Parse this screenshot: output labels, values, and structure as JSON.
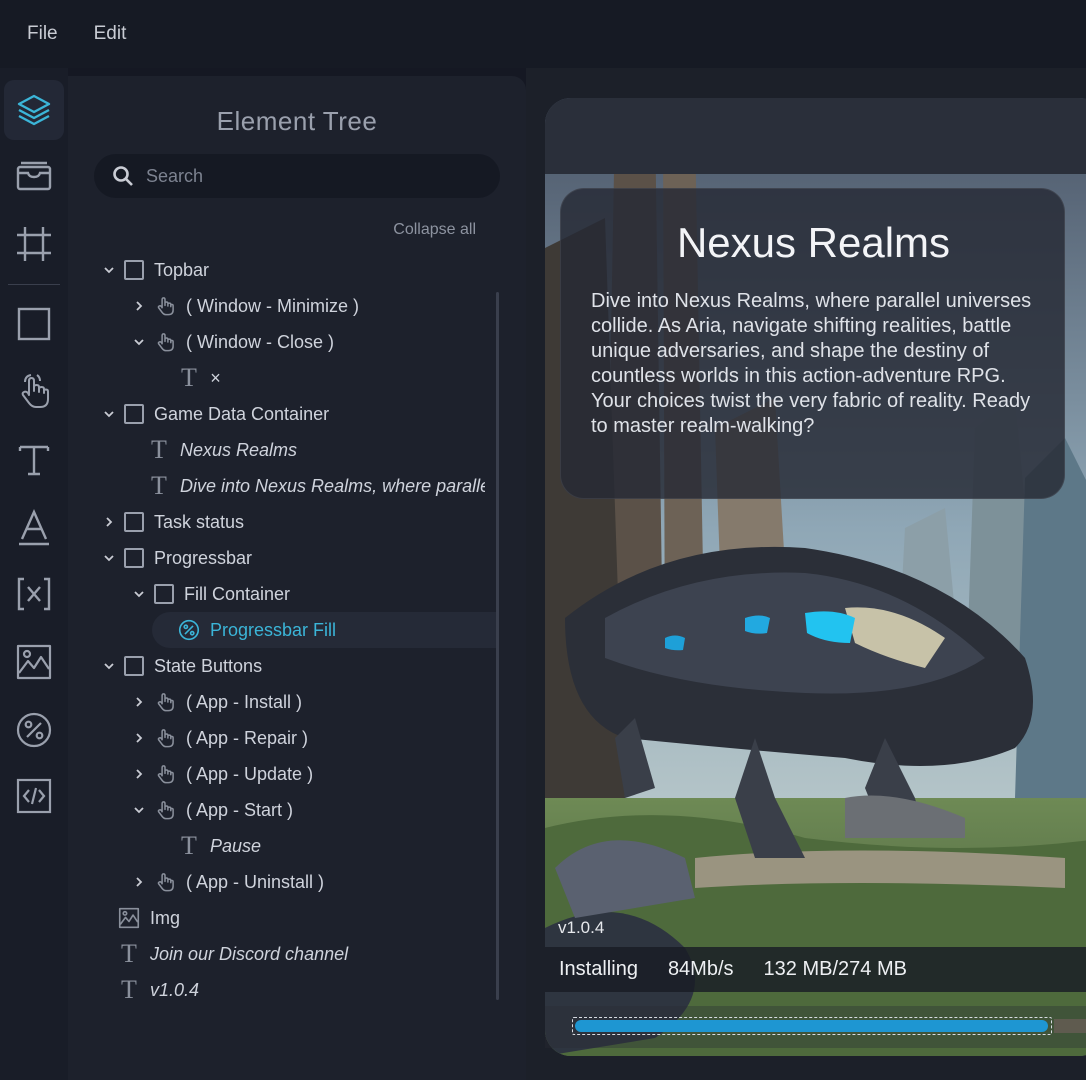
{
  "menu": {
    "file": "File",
    "edit": "Edit"
  },
  "toolbar": {
    "tools": [
      "layers-icon",
      "archive-icon",
      "frame-icon",
      "rectangle-icon",
      "pointer-hand-icon",
      "text-icon",
      "font-icon",
      "variable-icon",
      "image-icon",
      "percent-icon",
      "code-icon"
    ],
    "active": "layers-icon"
  },
  "panel": {
    "title": "Element Tree",
    "search_placeholder": "Search",
    "collapse_all": "Collapse all"
  },
  "tree": {
    "topbar": "Topbar",
    "window_minimize": "( Window - Minimize )",
    "window_close": "( Window - Close )",
    "close_glyph": "×",
    "game_data_container": "Game Data Container",
    "nexus_realms": "Nexus Realms",
    "dive_into": "Dive into Nexus Realms, where parallel",
    "task_status": "Task status",
    "progressbar": "Progressbar",
    "fill_container": "Fill Container",
    "progressbar_fill": "Progressbar Fill",
    "state_buttons": "State Buttons",
    "app_install": "( App - Install )",
    "app_repair": "( App - Repair )",
    "app_update": "( App - Update )",
    "app_start": "( App - Start )",
    "pause": "Pause",
    "app_uninstall": "( App - Uninstall )",
    "img": "Img",
    "discord": "Join our Discord channel",
    "version": "v1.0.4"
  },
  "preview": {
    "title": "Nexus Realms",
    "description": "Dive into Nexus Realms, where parallel universes collide. As Aria, navigate shifting realities, battle unique adversaries, and shape the destiny of countless worlds in this action-adventure RPG. Your choices twist the very fabric of reality. Ready to master realm-walking?",
    "version": "v1.0.4",
    "status": "Installing",
    "speed": "84Mb/s",
    "size": "132 MB/274 MB",
    "progress_fraction": 0.4818
  },
  "colors": {
    "accent": "#3bb5d8",
    "progress_fill": "#1e96d2",
    "panel_bg": "#1d212c",
    "app_bg": "#151823"
  }
}
